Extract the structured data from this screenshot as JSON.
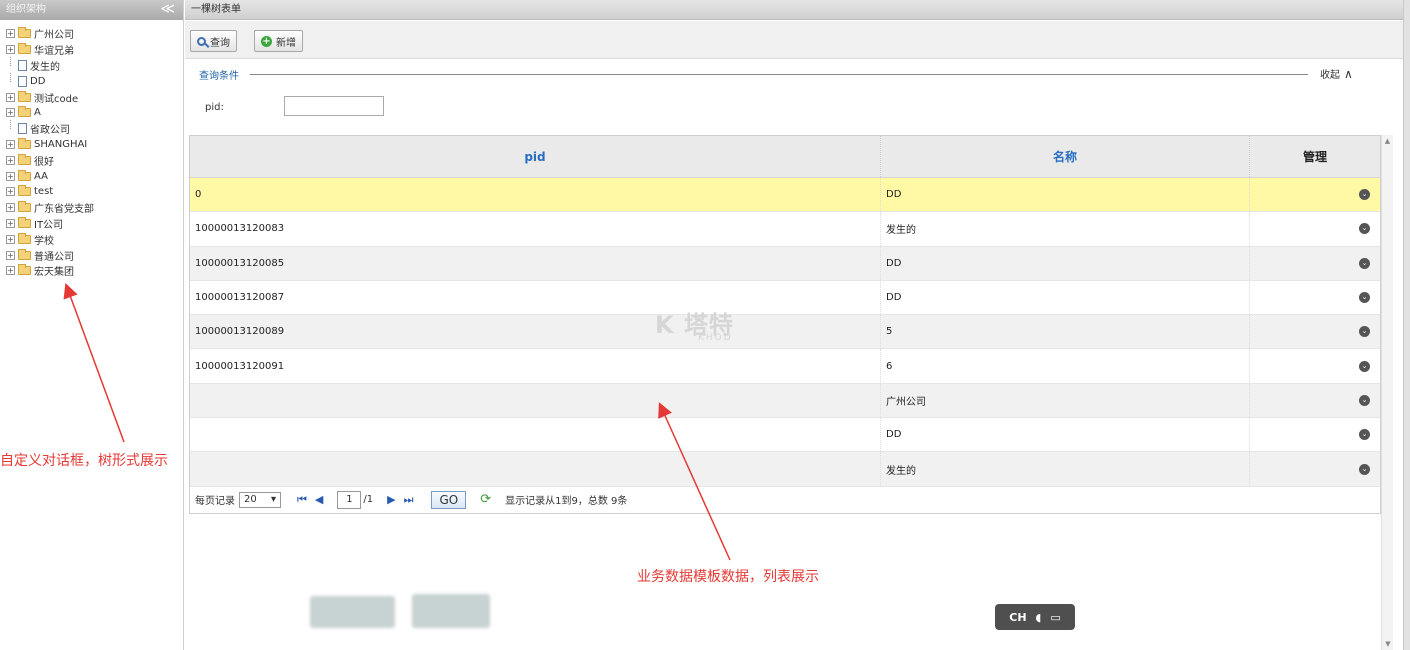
{
  "left": {
    "title": "组织架构",
    "collapse_glyph": "≪",
    "tree": [
      {
        "label": "广州公司",
        "type": "folder"
      },
      {
        "label": "华谊兄弟",
        "type": "folder"
      },
      {
        "label": "发生的",
        "type": "file"
      },
      {
        "label": "DD",
        "type": "file"
      },
      {
        "label": "测试code",
        "type": "folder"
      },
      {
        "label": "A",
        "type": "folder"
      },
      {
        "label": "省政公司",
        "type": "file"
      },
      {
        "label": "SHANGHAI",
        "type": "folder"
      },
      {
        "label": "很好",
        "type": "folder"
      },
      {
        "label": "AA",
        "type": "folder"
      },
      {
        "label": "test",
        "type": "folder"
      },
      {
        "label": "广东省党支部",
        "type": "folder"
      },
      {
        "label": "IT公司",
        "type": "folder"
      },
      {
        "label": "学校",
        "type": "folder"
      },
      {
        "label": "普通公司",
        "type": "folder"
      },
      {
        "label": "宏天集团",
        "type": "folder"
      }
    ]
  },
  "main": {
    "title": "一棵树表单",
    "toolbar": {
      "query_label": "查询",
      "add_label": "新增"
    },
    "query": {
      "title": "查询条件",
      "collapse_label": "收起",
      "collapse_glyph": "∧",
      "pid_label": "pid:",
      "pid_value": ""
    },
    "grid": {
      "columns": [
        "pid",
        "名称",
        "管理"
      ],
      "rows": [
        {
          "pid": "0",
          "name": "DD"
        },
        {
          "pid": "10000013120083",
          "name": "发生的"
        },
        {
          "pid": "10000013120085",
          "name": "DD"
        },
        {
          "pid": "10000013120087",
          "name": "DD"
        },
        {
          "pid": "10000013120089",
          "name": "5"
        },
        {
          "pid": "10000013120091",
          "name": "6"
        },
        {
          "pid": "",
          "name": "广州公司"
        },
        {
          "pid": "",
          "name": "DD"
        },
        {
          "pid": "",
          "name": "发生的"
        }
      ],
      "manage_glyph": "⌄"
    },
    "pager": {
      "per_page_label": "每页记录",
      "per_page_value": "20",
      "current_page": "1",
      "total_pages": "/1",
      "go_label": "GO",
      "summary": "显示记录从1到9，总数 9条"
    }
  },
  "annotations": {
    "left_note": "自定义对话框，树形式展示",
    "center_note": "业务数据模板数据，列表展示"
  },
  "watermark": {
    "main": "K 塔特",
    "sub": "KHOD"
  },
  "ime": {
    "label": "CH"
  },
  "colors": {
    "annotation": "#e53935",
    "selected_row": "#fff8a4",
    "link_blue": "#2266aa"
  }
}
